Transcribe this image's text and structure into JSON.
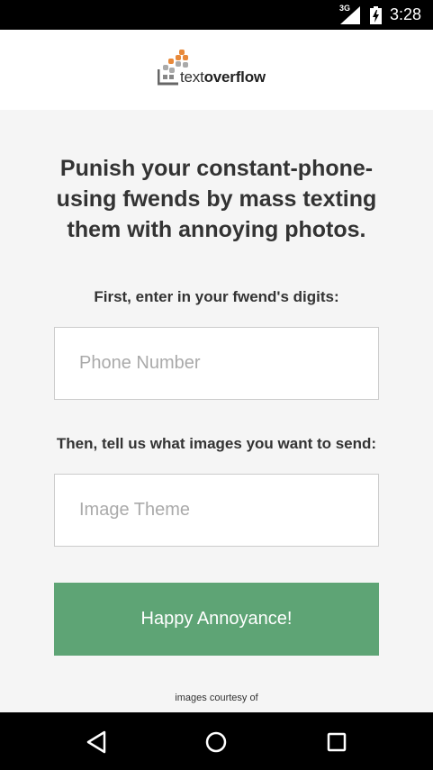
{
  "status_bar": {
    "network": "3G",
    "time": "3:28",
    "icons": [
      "signal-icon",
      "battery-charging-icon"
    ]
  },
  "header": {
    "logo_text_light": "text",
    "logo_text_bold": "overflow",
    "logo_icon": "dot-grid-logo-icon"
  },
  "main": {
    "headline": "Punish your constant-phone-using fwends by mass texting them with annoying photos.",
    "phone_label": "First, enter in your fwend's digits:",
    "phone_placeholder": "Phone Number",
    "theme_label": "Then, tell us what images you want to send:",
    "theme_placeholder": "Image Theme",
    "submit_label": "Happy Annoyance!",
    "credit": "images courtesy of"
  },
  "nav_bar": {
    "buttons": [
      "back-icon",
      "home-icon",
      "recent-apps-icon"
    ]
  },
  "colors": {
    "accent": "#5ea475",
    "logo_orange": "#e8893a",
    "background": "#f5f5f5",
    "status_bar": "#000000"
  }
}
